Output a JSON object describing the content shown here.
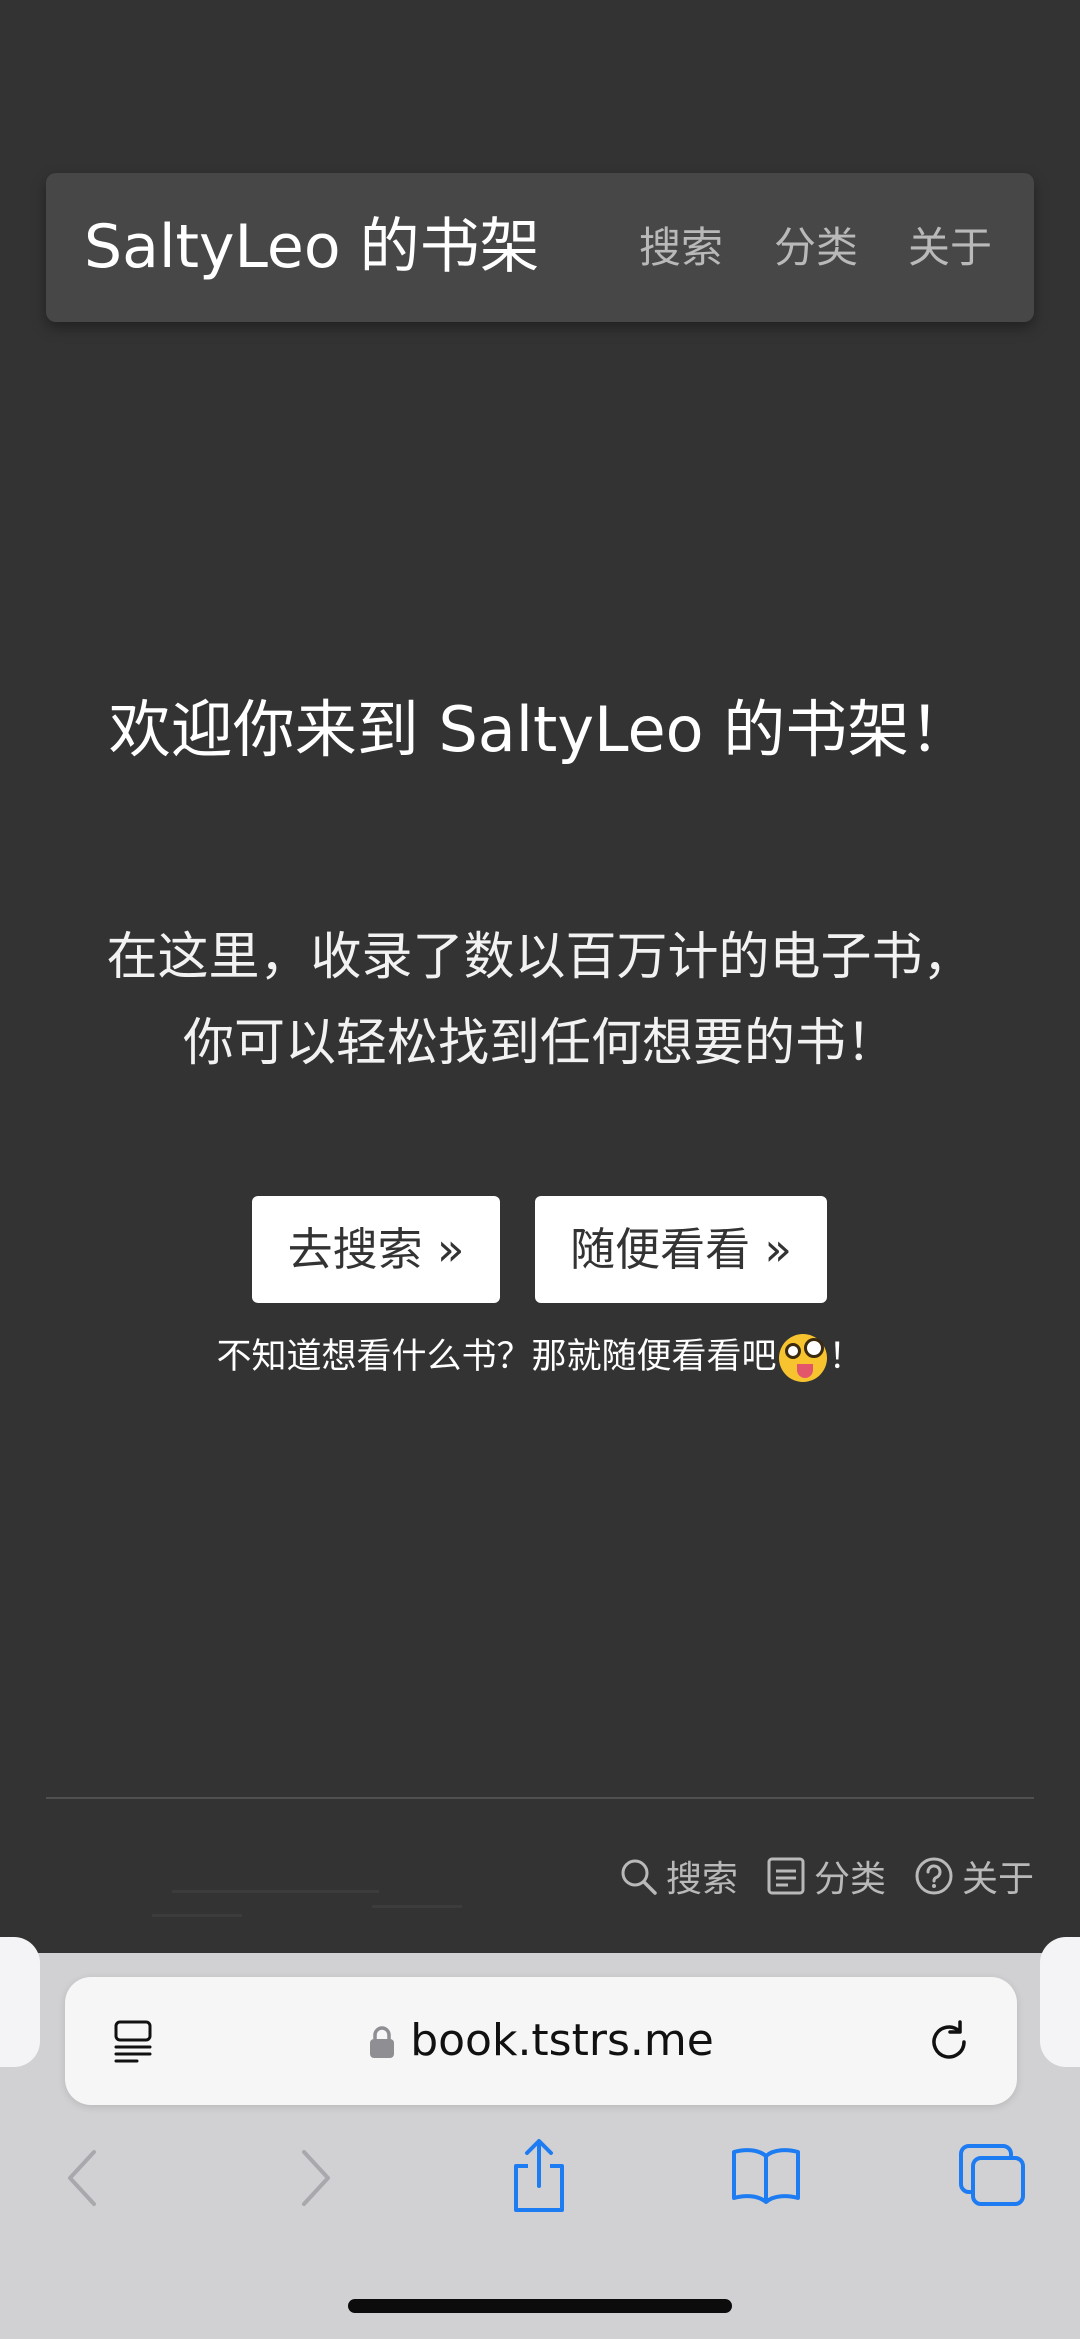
{
  "header": {
    "brand": "SaltyLeo 的书架",
    "nav": {
      "search": "搜索",
      "category": "分类",
      "about": "关于"
    }
  },
  "hero": {
    "title": "欢迎你来到 SaltyLeo 的书架！",
    "desc_line1": "在这里，收录了数以百万计的电子书，",
    "desc_line2": "你可以轻松找到任何想要的书！",
    "btn_search": "去搜索 »",
    "btn_random": "随便看看 »",
    "hint_before": "不知道想看什么书？那就随便看看吧",
    "hint_after": "！"
  },
  "footer": {
    "links": {
      "search": "搜索",
      "category": "分类",
      "about": "关于"
    }
  },
  "browser": {
    "url": "book.tstrs.me"
  },
  "colors": {
    "page_bg": "#333333",
    "nav_bg": "#474747",
    "accent_blue": "#1e7cf2"
  },
  "icons": {
    "emoji": "zany-face-icon",
    "footer_search": "search-icon",
    "footer_category": "document-icon",
    "footer_about": "question-icon"
  }
}
